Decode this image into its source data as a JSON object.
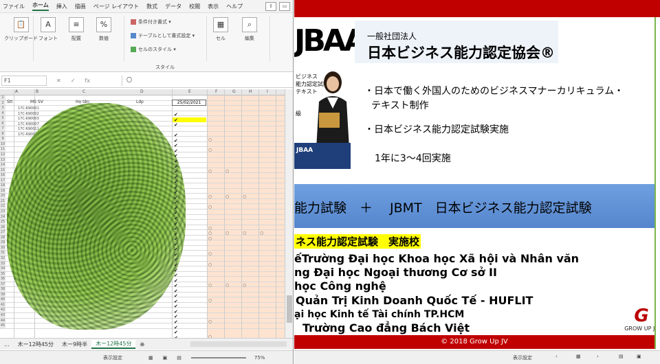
{
  "excel": {
    "menu": [
      "ファイル",
      "ホーム",
      "挿入",
      "描画",
      "ページ レイアウト",
      "数式",
      "データ",
      "校閲",
      "表示",
      "ヘルプ"
    ],
    "ribbon": {
      "clipboard": "クリップボード",
      "font": "フォント",
      "align": "配置",
      "number": "数値",
      "cond": "条件付き書式",
      "table": "テーブルとして書式設定",
      "cellstyle": "セルのスタイル",
      "styles": "スタイル",
      "cell": "セル",
      "edit": "編集"
    },
    "namebox": "F1",
    "formula": "〇",
    "columns": [
      "A",
      "B",
      "C",
      "D",
      "E",
      "F",
      "G",
      "H",
      "I"
    ],
    "header_row": {
      "no": "Stt",
      "id": "MS SV",
      "name": "Họ tên",
      "cls": "Lớp",
      "date": "25/02/2021"
    },
    "rows": [
      "1",
      "2",
      "3",
      "4",
      "5",
      "6",
      "7",
      "8",
      "9",
      "10",
      "11",
      "12",
      "13",
      "14",
      "15",
      "16",
      "17",
      "18",
      "19",
      "20",
      "21",
      "22",
      "23",
      "24",
      "25",
      "26",
      "27",
      "28",
      "29",
      "30",
      "31",
      "32",
      "33",
      "34",
      "35",
      "36",
      "37",
      "38",
      "39",
      "40",
      "41",
      "42",
      "43",
      "44",
      "45"
    ],
    "ids": [
      "17C-690001",
      "17C-690002",
      "17C-690003",
      "17C-690007",
      "17C-690011",
      "17C-690025"
    ],
    "sheet_tabs": [
      "...",
      "木ー12時45分",
      "木ー9時半",
      "木ー12時45分"
    ],
    "status": {
      "display": "表示設定",
      "zoom": "75%"
    }
  },
  "ppt": {
    "logo": "JBAA",
    "org_small": "一般社団法人",
    "org_big": "日本ビジネス能力認定協会®",
    "book_text": "ビジネス\n能力認定試験\nテキスト",
    "book_level": "級",
    "book_logo": "JBAA",
    "bullets": [
      "・日本で働く外国人のためのビジネスマナーカリキュラム・",
      "テキスト制作",
      "・日本ビジネス能力認定試験実施",
      "1年に3～4回実施"
    ],
    "band": "能力試験　＋　 JBMT　日本ビジネス能力認定試験",
    "schools_header": "ネス能力認定試験　実施校",
    "schools": [
      "ếTrường Đại học Khoa học Xã hội và Nhân văn",
      "ng Đại học Ngoại thương Cơ sở II",
      "học Công nghệ",
      "Quản Trị Kinh Doanh Quốc Tế - HUFLIT",
      "ại học Kinh tế Tài chính TP.HCM",
      "Trường Cao đẳng Bách Việt"
    ],
    "growup": "GROW UP JV",
    "footer": "© 2018 Grow Up JV",
    "status": {
      "display": "表示設定"
    }
  }
}
